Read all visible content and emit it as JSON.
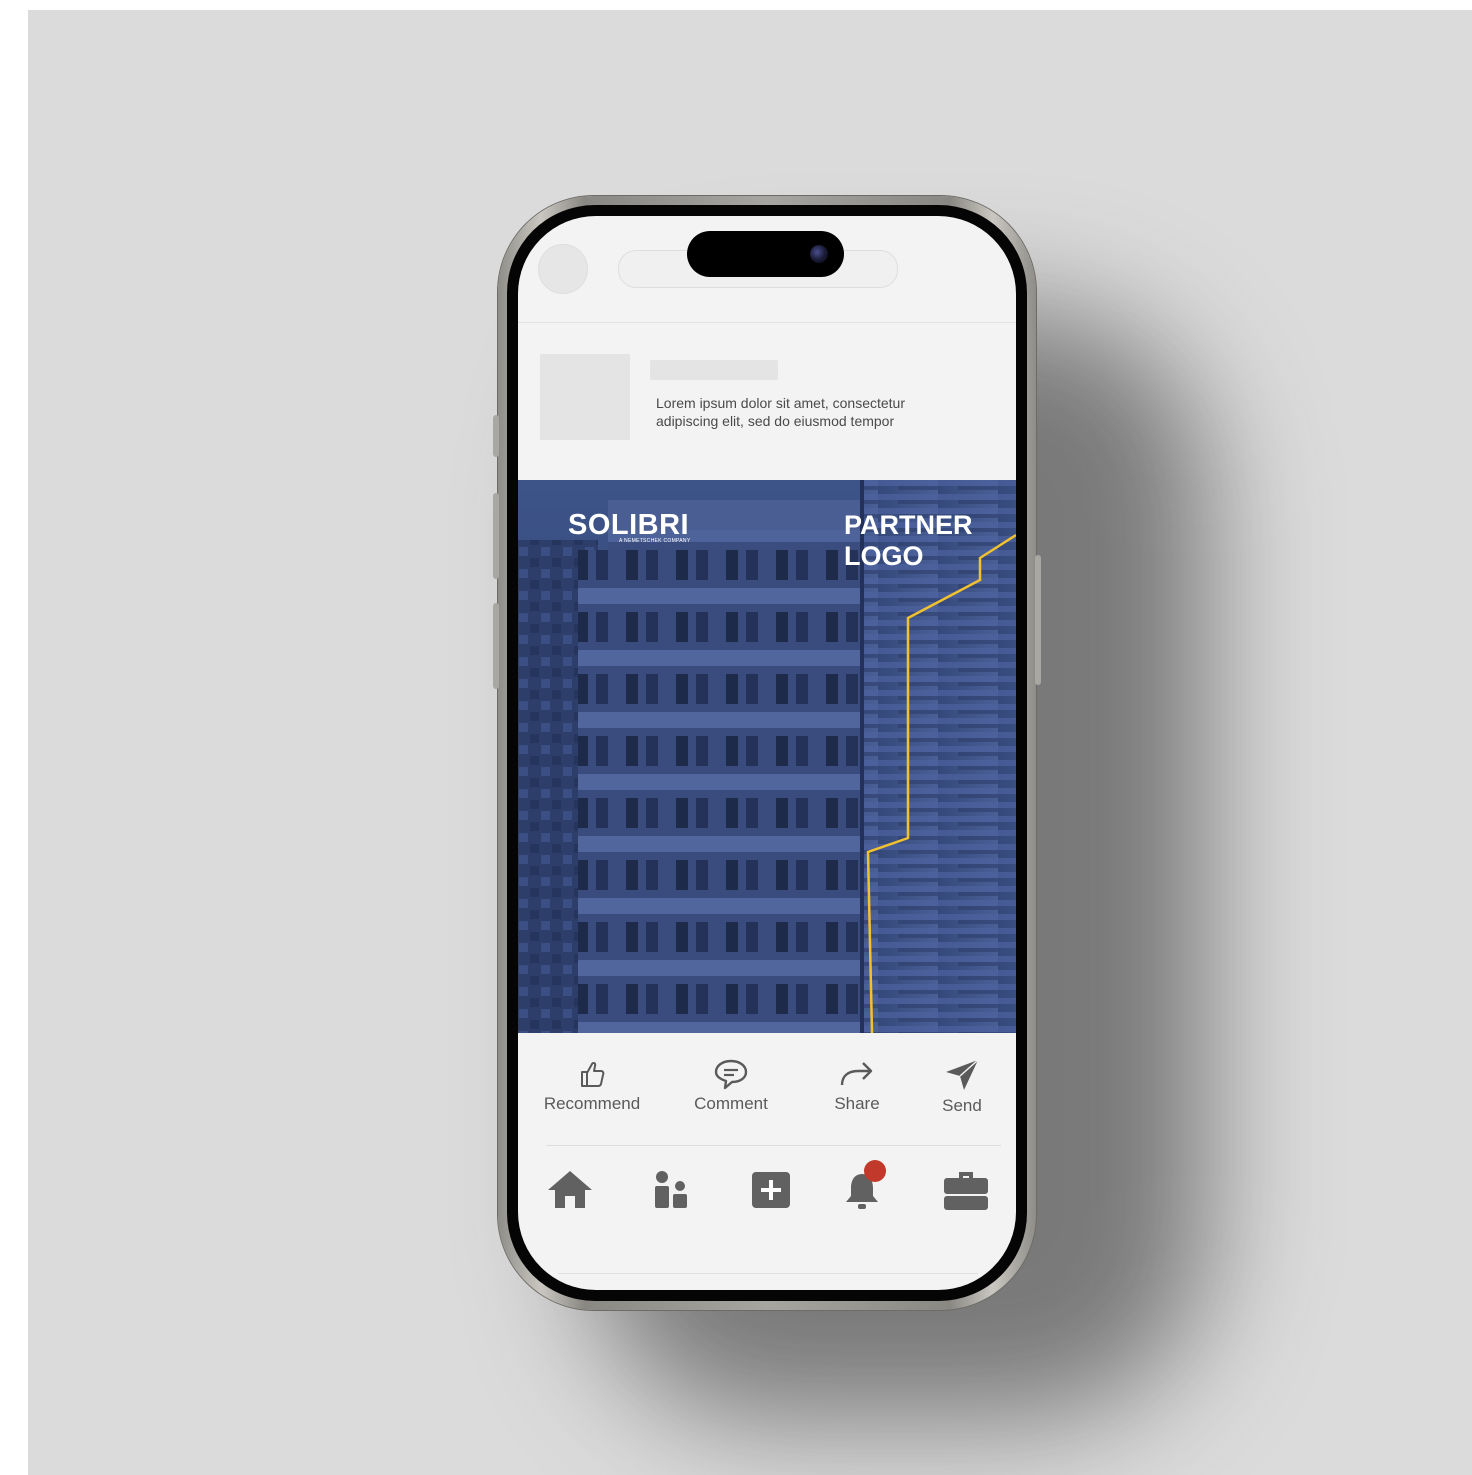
{
  "post": {
    "text_line1": "Lorem ipsum dolor sit amet, consectetur",
    "text_line2": "adipiscing elit, sed do eiusmod tempor"
  },
  "banner": {
    "brand_name": "SOLIBRI",
    "brand_tagline": "A NEMETSCHEK COMPANY",
    "partner_line1": "PARTNER",
    "partner_line2": "LOGO",
    "accent_color": "#f2c12e",
    "overlay_color": "#2f4375"
  },
  "actions": [
    {
      "label": "Recommend",
      "icon": "thumbs-up-icon"
    },
    {
      "label": "Comment",
      "icon": "comment-icon"
    },
    {
      "label": "Share",
      "icon": "share-arrow-icon"
    },
    {
      "label": "Send",
      "icon": "send-icon"
    }
  ],
  "bottom_nav": [
    {
      "icon": "home-icon"
    },
    {
      "icon": "network-icon"
    },
    {
      "icon": "post-plus-icon"
    },
    {
      "icon": "notifications-bell-icon",
      "has_badge": true,
      "badge_color": "#c0392b"
    },
    {
      "icon": "jobs-briefcase-icon"
    }
  ]
}
